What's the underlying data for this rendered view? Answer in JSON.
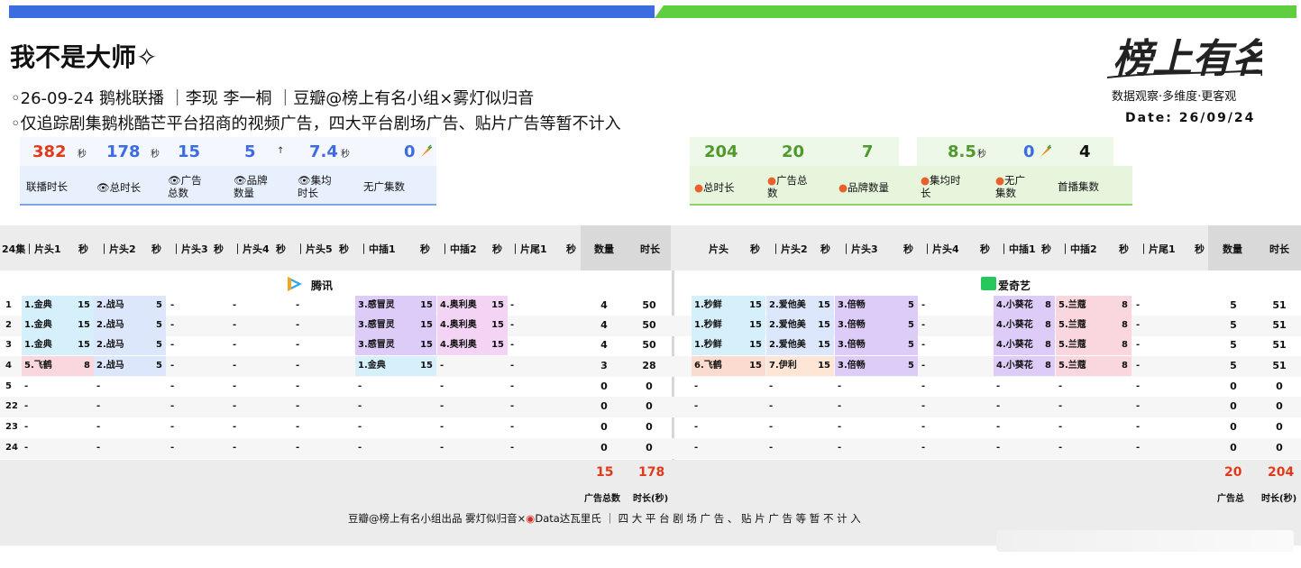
{
  "header": {
    "title": "我不是大师✧",
    "line1": "◦26-09-24  鹅桃联播 ｜李现 李一桐 ｜豆瓣@榜上有名小组×雾灯似归音",
    "line2": "◦仅追踪剧集鹅桃酷芒平台招商的视频广告，四大平台剧场广告、贴片广告等暂不计入"
  },
  "logo": {
    "mark": "榜上有名",
    "slogan": "数据观察·多维度·更客观",
    "date": "Date: 26/09/24"
  },
  "stats_left": {
    "values": [
      "382",
      "178",
      "15",
      "5",
      "7.4",
      "0"
    ],
    "units": [
      "秒",
      "秒",
      "",
      "↑",
      "秒",
      ""
    ],
    "labels": [
      "联播时长",
      "总时长",
      "广告\n总数",
      "品牌\n数量",
      "集均\n时长",
      "无广集数"
    ],
    "color_red": "#e03a1a",
    "color_blue": "#3c6de0"
  },
  "stats_right": {
    "values": [
      "204",
      "20",
      "7",
      "8.5",
      "0",
      "4"
    ],
    "units": [
      "",
      "",
      "",
      "秒",
      "",
      ""
    ],
    "labels": [
      "总时长",
      "广告总\n数",
      "品牌数量",
      "集均时\n长",
      "无广\n集数",
      "首播集数"
    ],
    "color_green": "#4f9a2c"
  },
  "table_head_left": [
    "24集",
    "｜片头1",
    "秒",
    "｜片头2",
    "秒",
    "｜片头3",
    "秒",
    "｜片头4",
    "秒",
    "｜片头5",
    "秒",
    "｜中插1",
    "秒",
    "｜中插2",
    "秒",
    "｜片尾1",
    "秒",
    "数量",
    "时长"
  ],
  "table_head_right": [
    "片头",
    "秒",
    "｜片头2",
    "秒",
    "｜片头3",
    "秒",
    "｜片头4",
    "秒",
    "｜中插1",
    "秒",
    "｜中插2",
    "秒",
    "｜片尾1",
    "秒",
    "数量",
    "时长"
  ],
  "platform_left": "腾讯",
  "platform_right": "爱奇艺",
  "platform_right_icon": "iQIYI",
  "rows": [
    {
      "ep": "1",
      "l_p1": "1.金典",
      "l_p1s": "15",
      "l_p2": "2.战马",
      "l_p2s": "5",
      "l_m1": "3.感冒灵",
      "l_m1s": "15",
      "l_m2": "4.奥利奥",
      "l_m2s": "15",
      "l_cnt": "4",
      "l_dur": "50",
      "r_p1": "1.秒鲜",
      "r_p1s": "15",
      "r_p2": "2.爱他美",
      "r_p2s": "15",
      "r_p3": "3.倍畅",
      "r_p3s": "5",
      "r_m1": "4.小葵花",
      "r_m1s": "8",
      "r_m2": "5.兰蔻",
      "r_m2s": "8",
      "r_cnt": "5",
      "r_dur": "51"
    },
    {
      "ep": "2",
      "l_p1": "1.金典",
      "l_p1s": "15",
      "l_p2": "2.战马",
      "l_p2s": "5",
      "l_m1": "3.感冒灵",
      "l_m1s": "15",
      "l_m2": "4.奥利奥",
      "l_m2s": "15",
      "l_cnt": "4",
      "l_dur": "50",
      "r_p1": "1.秒鲜",
      "r_p1s": "15",
      "r_p2": "2.爱他美",
      "r_p2s": "15",
      "r_p3": "3.倍畅",
      "r_p3s": "5",
      "r_m1": "4.小葵花",
      "r_m1s": "8",
      "r_m2": "5.兰蔻",
      "r_m2s": "8",
      "r_cnt": "5",
      "r_dur": "51"
    },
    {
      "ep": "3",
      "l_p1": "1.金典",
      "l_p1s": "15",
      "l_p2": "2.战马",
      "l_p2s": "5",
      "l_m1": "3.感冒灵",
      "l_m1s": "15",
      "l_m2": "4.奥利奥",
      "l_m2s": "15",
      "l_cnt": "4",
      "l_dur": "50",
      "r_p1": "1.秒鲜",
      "r_p1s": "15",
      "r_p2": "2.爱他美",
      "r_p2s": "15",
      "r_p3": "3.倍畅",
      "r_p3s": "5",
      "r_m1": "4.小葵花",
      "r_m1s": "8",
      "r_m2": "5.兰蔻",
      "r_m2s": "8",
      "r_cnt": "5",
      "r_dur": "51"
    },
    {
      "ep": "4",
      "l_p1": "5.飞鹤",
      "l_p1s": "8",
      "l_p2": "2.战马",
      "l_p2s": "5",
      "l_m1": "1.金典",
      "l_m1s": "15",
      "l_m2": "-",
      "l_m2s": "",
      "l_cnt": "3",
      "l_dur": "28",
      "r_p1": "6.飞鹤",
      "r_p1s": "15",
      "r_p2": "7.伊利",
      "r_p2s": "15",
      "r_p3": "3.倍畅",
      "r_p3s": "5",
      "r_m1": "4.小葵花",
      "r_m1s": "8",
      "r_m2": "5.兰蔻",
      "r_m2s": "8",
      "r_cnt": "5",
      "r_dur": "51"
    },
    {
      "ep": "5",
      "l_cnt": "0",
      "l_dur": "0",
      "r_cnt": "0",
      "r_dur": "0"
    },
    {
      "ep": "22",
      "l_cnt": "0",
      "l_dur": "0",
      "r_cnt": "0",
      "r_dur": "0"
    },
    {
      "ep": "23",
      "l_cnt": "0",
      "l_dur": "0",
      "r_cnt": "0",
      "r_dur": "0"
    },
    {
      "ep": "24",
      "l_cnt": "0",
      "l_dur": "0",
      "r_cnt": "0",
      "r_dur": "0"
    }
  ],
  "dash": "-",
  "footer": {
    "left_total_count": "15",
    "left_total_dur": "178",
    "left_label_count": "广告总数",
    "left_label_dur": "时长(秒)",
    "right_total_count": "20",
    "right_total_dur": "204",
    "right_label_count": "广告总",
    "right_label_dur": "时长(秒)",
    "credit": "豆瓣@榜上有名小组出品 雾灯似归音×",
    "credit_weibo": "Data达瓦里氏 ｜ 四 大 平 台 剧 场 广 告 、 贴 片 广 告 等 暂 不 计 入"
  }
}
